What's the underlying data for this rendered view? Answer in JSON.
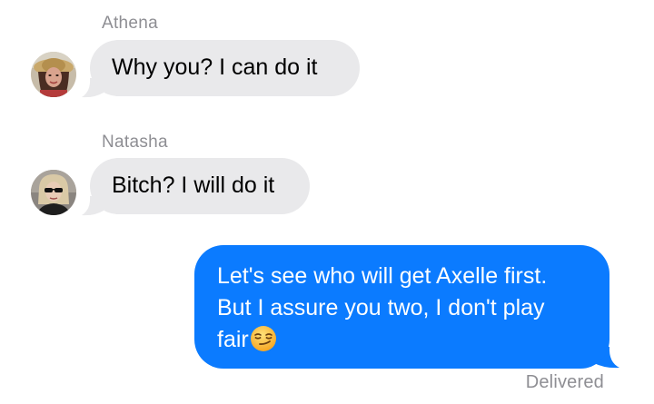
{
  "conversation": {
    "messages": [
      {
        "sender": "Athena",
        "direction": "incoming",
        "text": "Why you? I can do it",
        "avatar_icon": "avatar-photo-athena"
      },
      {
        "sender": "Natasha",
        "direction": "incoming",
        "text": "Bitch? I will do it",
        "avatar_icon": "avatar-photo-natasha"
      },
      {
        "sender": "",
        "direction": "outgoing",
        "lines": [
          "Let's see who will get Axelle first.",
          "But I assure you two, I don't play",
          "fair"
        ],
        "emoji_icon": "smirking-face-emoji-icon"
      }
    ],
    "status": "Delivered"
  },
  "colors": {
    "incoming_bubble": "#e9e9eb",
    "outgoing_bubble": "#0b7bff",
    "secondary_text": "#8e8e93"
  }
}
